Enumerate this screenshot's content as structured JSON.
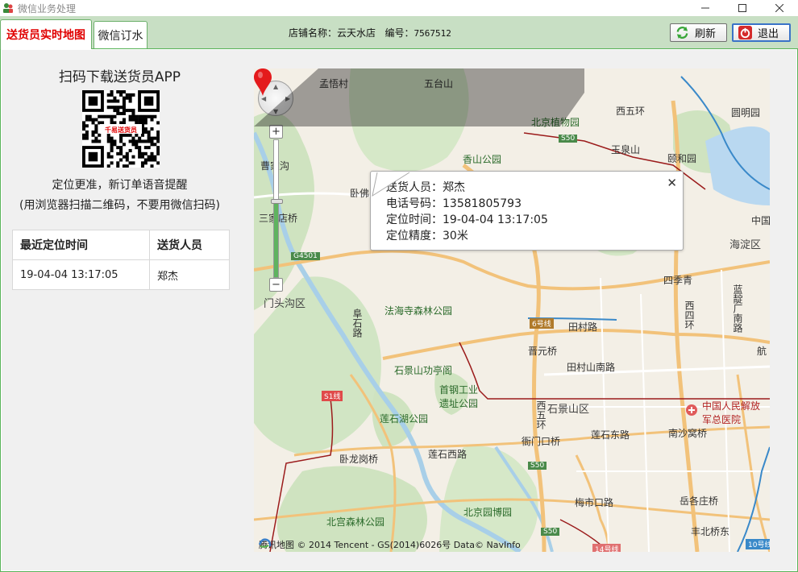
{
  "window": {
    "title": "微信业务处理",
    "controls": [
      "minimize-icon",
      "maximize-icon",
      "close-icon"
    ]
  },
  "tabs": [
    {
      "label": "送货员实时地图",
      "active": true
    },
    {
      "label": "微信订水",
      "active": false
    }
  ],
  "store": {
    "name_label": "店铺名称：",
    "name": "云天水店",
    "id_label": "编号：",
    "id": "7567512"
  },
  "toolbar": {
    "refresh_label": "刷新",
    "exit_label": "退出"
  },
  "left": {
    "qr_title": "扫码下载送货员APP",
    "qr_caption": "千易送货员",
    "tip1": "定位更准，新订单语音提醒",
    "tip2": "(用浏览器扫描二维码，不要用微信扫码)",
    "table": {
      "headers": [
        "最近定位时间",
        "送货人员"
      ],
      "rows": [
        [
          "19-04-04 13:17:05",
          "郑杰"
        ]
      ]
    }
  },
  "map": {
    "zoom_level_fraction": 0.55,
    "info": {
      "courier_label": "送货人员：",
      "courier": "郑杰",
      "phone_label": "电话号码：",
      "phone": "13581805793",
      "time_label": "定位时间：",
      "time": "19-04-04 13:17:05",
      "accuracy_label": "定位精度：",
      "accuracy": "30米"
    },
    "labels": {
      "l1": "孟悟村",
      "l2": "五台山",
      "l3": "北京植物园",
      "l4": "西五环",
      "l5": "圆明园",
      "l6": "玉泉山",
      "l7": "颐和园",
      "l8": "香山公园",
      "l9": "曹家沟",
      "l10": "卧佛",
      "l11": "三家店桥",
      "l12": "海淀区",
      "l13": "中国",
      "l14": "G4501",
      "l15": "门头沟区",
      "l16": "四季青",
      "l17": "西四环",
      "l18": "蓝靛厂南路",
      "l19": "法海寺森林公园",
      "l20": "田村路",
      "l21": "晋元桥",
      "l22": "阜石路",
      "l23": "石景山功亭阁",
      "l24": "田村山南路",
      "l25": "首钢工业遗址公园",
      "l26": "石景山区",
      "l27": "莲石湖公园",
      "l28": "中国人民解放军总医院",
      "l29": "衙门口桥",
      "l30": "莲石东路",
      "l31": "南沙窝桥",
      "l32": "卧龙岗桥",
      "l33": "莲石西路",
      "l34": "北宫森林公园",
      "l35": "北京园博园",
      "l36": "梅市口路",
      "l37": "岳各庄桥",
      "l38": "丰北桥东",
      "l39": "西五环",
      "l40": "S50",
      "l41": "S1线",
      "l42": "6号线",
      "l43": "14号线",
      "l44": "10号线",
      "l45": "航",
      "l46": "S50",
      "l47": "S50"
    },
    "copyright": "腾讯地图  © 2014 Tencent - GS(2014)6026号  Data© NavInfo"
  },
  "colors": {
    "tab_active_text": "#e00000",
    "toolbar_bg": "#c8dfc4",
    "frame_border": "#59b359",
    "marker": "#e41a1c"
  }
}
